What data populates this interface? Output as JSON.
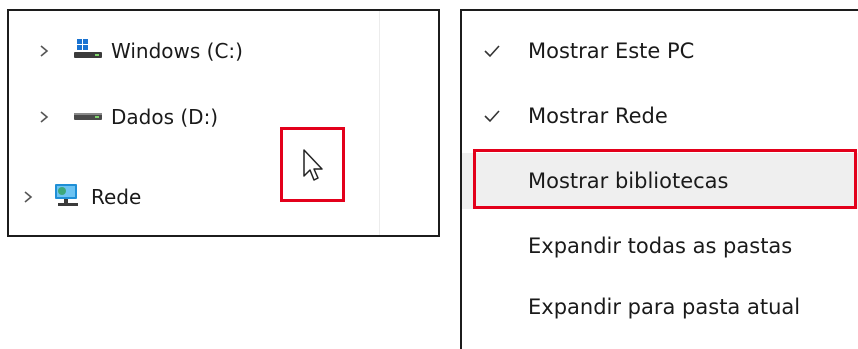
{
  "nav_pane": {
    "items": [
      {
        "label": "Windows (C:)",
        "icon": "windows-drive-icon",
        "expanded": false
      },
      {
        "label": "Dados (D:)",
        "icon": "drive-icon",
        "expanded": false
      },
      {
        "label": "Rede",
        "icon": "network-icon",
        "expanded": false
      }
    ]
  },
  "context_menu": {
    "items": [
      {
        "label": "Mostrar Este PC",
        "checked": true
      },
      {
        "label": "Mostrar Rede",
        "checked": true
      },
      {
        "label": "Mostrar bibliotecas",
        "checked": false,
        "highlighted": true
      },
      {
        "label": "Expandir todas as pastas",
        "checked": false
      },
      {
        "label": "Expandir para pasta atual",
        "checked": false
      }
    ]
  },
  "colors": {
    "highlight_border": "#e3001b",
    "hover_background": "#efefef",
    "network_icon": "#1f8fd6"
  }
}
